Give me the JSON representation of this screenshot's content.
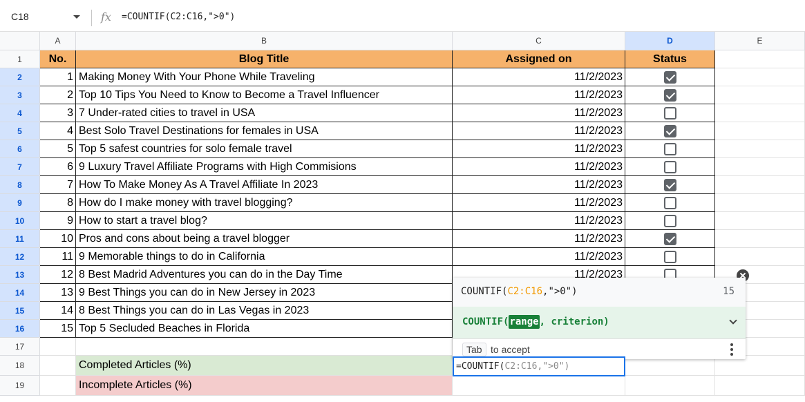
{
  "formula_bar": {
    "name_box": "C18",
    "fx": "fx",
    "formula": "=COUNTIF(C2:C16,\">0\")"
  },
  "columns": [
    "A",
    "B",
    "C",
    "D",
    "E"
  ],
  "headers": {
    "no": "No.",
    "title": "Blog Title",
    "assigned": "Assigned on",
    "status": "Status"
  },
  "rows": [
    {
      "n": "1",
      "no": "1",
      "title": "Making Money With Your Phone While Traveling",
      "date": "11/2/2023",
      "done": true
    },
    {
      "n": "2",
      "no": "2",
      "title": "Top 10 Tips You Need to Know to Become a Travel Influencer",
      "date": "11/2/2023",
      "done": true
    },
    {
      "n": "3",
      "no": "3",
      "title": "7 Under-rated cities to travel in USA",
      "date": "11/2/2023",
      "done": false
    },
    {
      "n": "4",
      "no": "4",
      "title": "Best Solo Travel Destinations for females in USA",
      "date": "11/2/2023",
      "done": true
    },
    {
      "n": "5",
      "no": "5",
      "title": "Top 5 safest countries for solo female travel",
      "date": "11/2/2023",
      "done": false
    },
    {
      "n": "6",
      "no": "6",
      "title": "9 Luxury Travel Affiliate Programs with High Commisions",
      "date": "11/2/2023",
      "done": false
    },
    {
      "n": "7",
      "no": "7",
      "title": "How To Make Money As A Travel Affiliate In 2023",
      "date": "11/2/2023",
      "done": true
    },
    {
      "n": "8",
      "no": "8",
      "title": "How do I make money with travel blogging?",
      "date": "11/2/2023",
      "done": false
    },
    {
      "n": "9",
      "no": "9",
      "title": "How to start a travel blog?",
      "date": "11/2/2023",
      "done": false
    },
    {
      "n": "10",
      "no": "10",
      "title": "Pros and cons about being a travel blogger",
      "date": "11/2/2023",
      "done": true
    },
    {
      "n": "11",
      "no": "11",
      "title": "9 Memorable things to do in California",
      "date": "11/2/2023",
      "done": false
    },
    {
      "n": "12",
      "no": "12",
      "title": "8 Best Madrid Adventures you can do in the Day Time",
      "date": "11/2/2023",
      "done": false
    },
    {
      "n": "13",
      "no": "13",
      "title": "9 Best Things you can do in New Jersey in 2023",
      "date": "",
      "done": null
    },
    {
      "n": "14",
      "no": "14",
      "title": "8 Best Things you can do in Las Vegas in 2023",
      "date": "",
      "done": null
    },
    {
      "n": "15",
      "no": "15",
      "title": "Top 5 Secluded Beaches in Florida",
      "date": "",
      "done": null
    }
  ],
  "summary": {
    "completed": "Completed Articles (%)",
    "incomplete": "Incomplete Articles (%)",
    "completed_color": "#d9ead3",
    "incomplete_color": "#f4cccc"
  },
  "popup": {
    "signature_fn": "COUNTIF(",
    "signature_range": "C2:C16",
    "signature_rest": ",\">0\")",
    "result": "15",
    "help_fn": "COUNTIF(",
    "help_arg": "range",
    "help_rest": ", criterion)",
    "tab_key": "Tab",
    "tab_text": "to accept"
  },
  "edit_cell": {
    "prefix": "=COUNTIF(",
    "range": "C2:C16,\">0\")"
  },
  "colors": {
    "header_orange": "#f6b26b",
    "selection_blue": "#d3e3fd",
    "accent_blue": "#1a73e8"
  }
}
